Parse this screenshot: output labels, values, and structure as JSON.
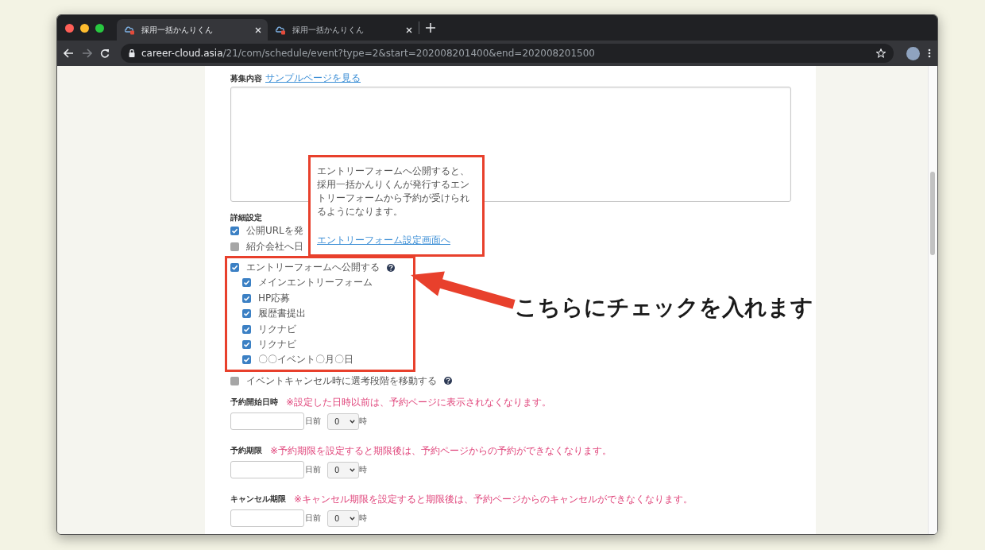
{
  "browser": {
    "tabs": [
      {
        "title": "採用一括かんりくん",
        "selected": true
      },
      {
        "title": "採用一括かんりくん",
        "selected": false
      }
    ],
    "url_host": "career-cloud.asia",
    "url_path": "/21/com/schedule/event?type=2&start=202008201400&end=202008201500"
  },
  "form": {
    "content_label": "募集内容",
    "sample_link": "サンプルページを見る",
    "details_heading": "詳細設定",
    "options": [
      {
        "label": "公開URLを発",
        "checked": true,
        "help": false,
        "highlighted": false
      },
      {
        "label": "紹介会社へ日",
        "checked": false,
        "help": false,
        "highlighted": false
      },
      {
        "label": "エントリーフォームへ公開する",
        "checked": true,
        "help": true,
        "highlighted": true,
        "children": [
          {
            "label": "メインエントリーフォーム",
            "checked": true
          },
          {
            "label": "HP応募",
            "checked": true
          },
          {
            "label": "履歴書提出",
            "checked": true
          },
          {
            "label": "リクナビ",
            "checked": true
          },
          {
            "label": "リクナビ",
            "checked": true
          },
          {
            "label": "〇〇イベント〇月〇日",
            "checked": true
          }
        ]
      },
      {
        "label": "イベントキャンセル時に選考段階を移動する",
        "checked": false,
        "help": true,
        "highlighted": false
      }
    ],
    "schedule_fields": [
      {
        "label": "予約開始日時",
        "note": "※設定した日時以前は、予約ページに表示されなくなります。",
        "unit_days": "日前",
        "hour": "0",
        "unit_hour": "時"
      },
      {
        "label": "予約期限",
        "note": "※予約期限を設定すると期限後は、予約ページからの予約ができなくなります。",
        "unit_days": "日前",
        "hour": "0",
        "unit_hour": "時"
      },
      {
        "label": "キャンセル期限",
        "note": "※キャンセル期限を設定すると期限後は、予約ページからのキャンセルができなくなります。",
        "unit_days": "日前",
        "hour": "0",
        "unit_hour": "時"
      }
    ]
  },
  "tooltip": {
    "text": "エントリーフォームへ公開すると、採用一括かんりくんが発行するエントリーフォームから予約が受けられるようになります。",
    "link": "エントリーフォーム設定画面へ"
  },
  "annotation": {
    "text": "こちらにチェックを入れます"
  }
}
